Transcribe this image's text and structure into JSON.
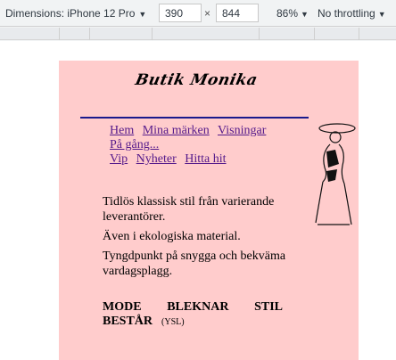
{
  "devtools": {
    "device_label": "Dimensions: iPhone 12 Pro",
    "width_value": "390",
    "height_value": "844",
    "times_sign": "×",
    "zoom": "86%",
    "throttle": "No throttling"
  },
  "page": {
    "logo_text": "Butik Monika",
    "nav": [
      "Hem",
      "Mina märken",
      "Visningar",
      "På gång...",
      "Vip",
      "Nyheter",
      "Hitta hit"
    ],
    "paragraphs": [
      "Tidlös klassisk stil från varierande leverantörer.",
      "Även i ekologiska material.",
      "Tyngdpunkt på snygga och bekväma vardagsplagg."
    ],
    "quote": {
      "words_row1": [
        "MODE",
        "BLEKNAR",
        "STIL"
      ],
      "word_row2": "BESTÅR",
      "attribution": "(YSL)"
    }
  }
}
